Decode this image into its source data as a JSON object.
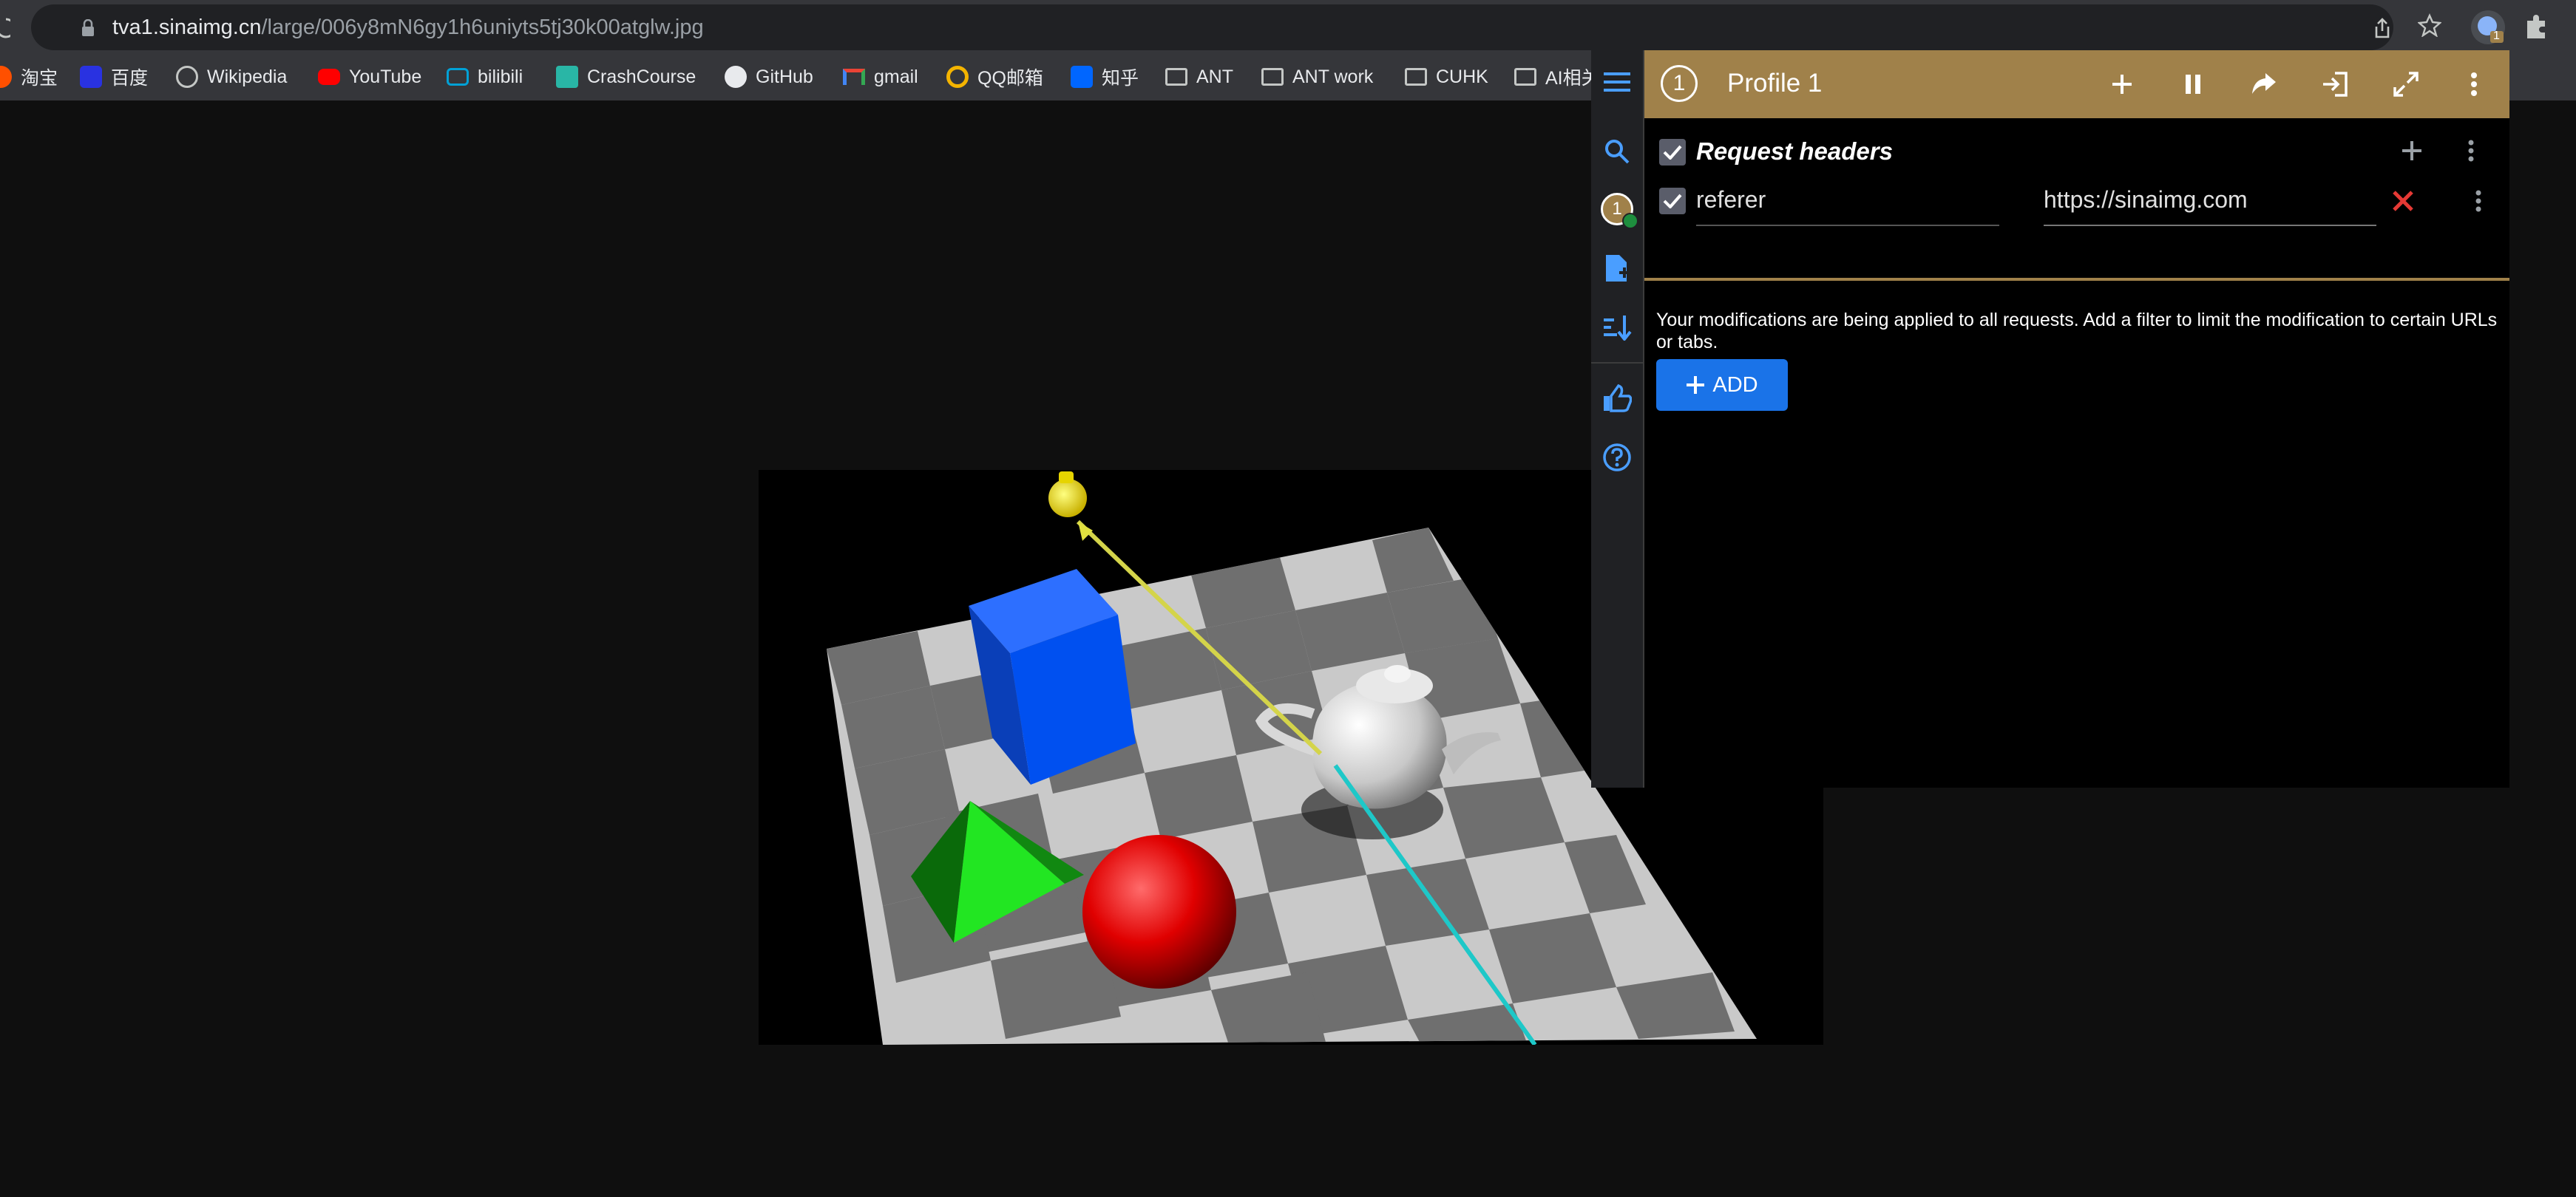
{
  "browser": {
    "url_host": "tva1.sinaimg.cn",
    "url_path": "/large/006y8mN6gy1h6uniyts5tj30k00atglw.jpg",
    "ext_badge": "1"
  },
  "bookmarks": [
    {
      "label": "淘宝",
      "icon": "taobao-icon"
    },
    {
      "label": "百度",
      "icon": "baidu-icon"
    },
    {
      "label": "Wikipedia",
      "icon": "globe-icon"
    },
    {
      "label": "YouTube",
      "icon": "youtube-icon"
    },
    {
      "label": "bilibili",
      "icon": "bilibili-icon"
    },
    {
      "label": "CrashCourse",
      "icon": "crashcourse-icon"
    },
    {
      "label": "GitHub",
      "icon": "github-icon"
    },
    {
      "label": "gmail",
      "icon": "gmail-icon"
    },
    {
      "label": "QQ邮箱",
      "icon": "qqmail-icon"
    },
    {
      "label": "知乎",
      "icon": "zhihu-icon"
    },
    {
      "label": "ANT",
      "icon": "folder-icon"
    },
    {
      "label": "ANT work",
      "icon": "folder-icon"
    },
    {
      "label": "CUHK",
      "icon": "folder-icon"
    },
    {
      "label": "AI相关",
      "icon": "folder-icon"
    }
  ],
  "extension": {
    "profile_number": "1",
    "profile_title": "Profile 1",
    "section_title": "Request headers",
    "header_row": {
      "name": "referer",
      "value": "https://sinaimg.com",
      "enabled": true
    },
    "notice": "Your modifications are being applied to all requests. Add a filter to limit the modification to certain URLs or tabs.",
    "add_button_label": "ADD",
    "sidebar_profile_badge": "1",
    "colors": {
      "header_bg": "#a0814a",
      "accent": "#1a73e8",
      "delete": "#e53935"
    }
  }
}
